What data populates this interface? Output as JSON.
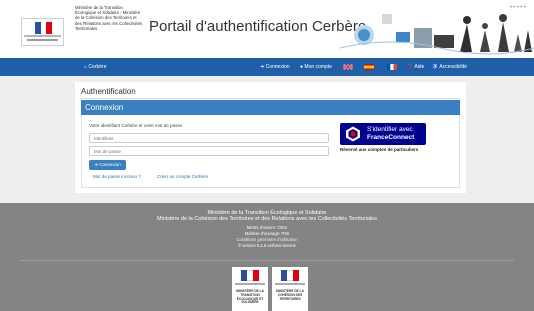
{
  "header": {
    "ministries_text": "Ministère de la Transition Écologique et Solidaire - Ministère de la Cohésion des Territoires et des Relations avec les Collectivités Territoriales",
    "portal_title": "Portail d'authentification Cerbère",
    "dots": "•••••"
  },
  "nav": {
    "brand": "Cerbère",
    "connexion": "Connexion",
    "mon_compte": "Mon compte",
    "aide": "Aide",
    "accessibilite": "Accessibilité"
  },
  "main": {
    "auth_title": "Authentification",
    "connexion_header": "Connexion",
    "lead": "Votre identifiant Cerbère et votre mot de passe",
    "identifiant_placeholder": "Identifiant",
    "password_placeholder": "Mot de passe",
    "submit_label": "Connexion",
    "forgot_link": "Mot de passe inconnu ?",
    "create_link": "Créer un compte Cerbère"
  },
  "franceconnect": {
    "line1": "S'identifier avec",
    "line2": "FranceConnect",
    "note": "Réservé aux comptes de particuliers"
  },
  "footer": {
    "line1": "Ministère de la Transition Écologique et Solidaire",
    "line2": "Ministère de la Cohésion des Territoires et des Relations avec les Collectivités Territoriales",
    "line3": "Mettre d'œuvre: CEIS",
    "line4": "Maîtrise d'ouvrage: PSII",
    "line5": "Conditions générales d'utilisation",
    "line6": "© version 5.1.5 cerbere-interne",
    "logo1_text": "MINISTÈRE DE LA TRANSITION ÉCOLOGIQUE ET SOLIDAIRE",
    "logo2_text": "MINISTÈRE DE LA COHÉSION DES TERRITOIRES"
  },
  "colors": {
    "nav_blue": "#1e5fa8",
    "panel_blue": "#3a7fc1",
    "franceconnect_blue": "#000091",
    "footer_gray": "#848484"
  }
}
